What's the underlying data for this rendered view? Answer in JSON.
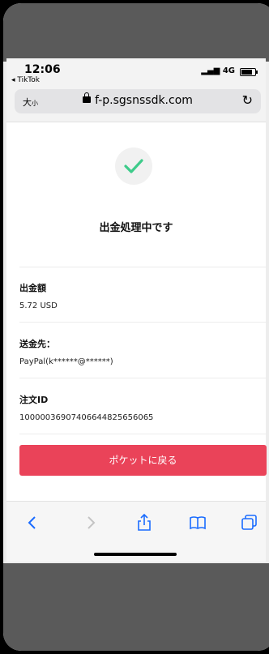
{
  "status_bar": {
    "time": "12:06",
    "back_app": "◂ TikTok",
    "network": "4G"
  },
  "browser": {
    "text_size": "大",
    "text_size_small": "小",
    "url": "f-p.sgsnssdk.com"
  },
  "page": {
    "heading": "出金処理中です",
    "fields": [
      {
        "label": "出金額",
        "value": "5.72 USD"
      },
      {
        "label": "送金先：",
        "value": "PayPal(k******@******)"
      },
      {
        "label": "注文ID",
        "value": "1000003690740664482565606​5"
      }
    ],
    "return_button": "ポケットに戻る"
  },
  "colors": {
    "accent": "#ea4359",
    "check": "#3ecb8a",
    "toolbar_icons": "#1a6cff"
  },
  "toolbar_icons": [
    "back-icon",
    "forward-icon",
    "share-icon",
    "bookmarks-icon",
    "tabs-icon"
  ]
}
